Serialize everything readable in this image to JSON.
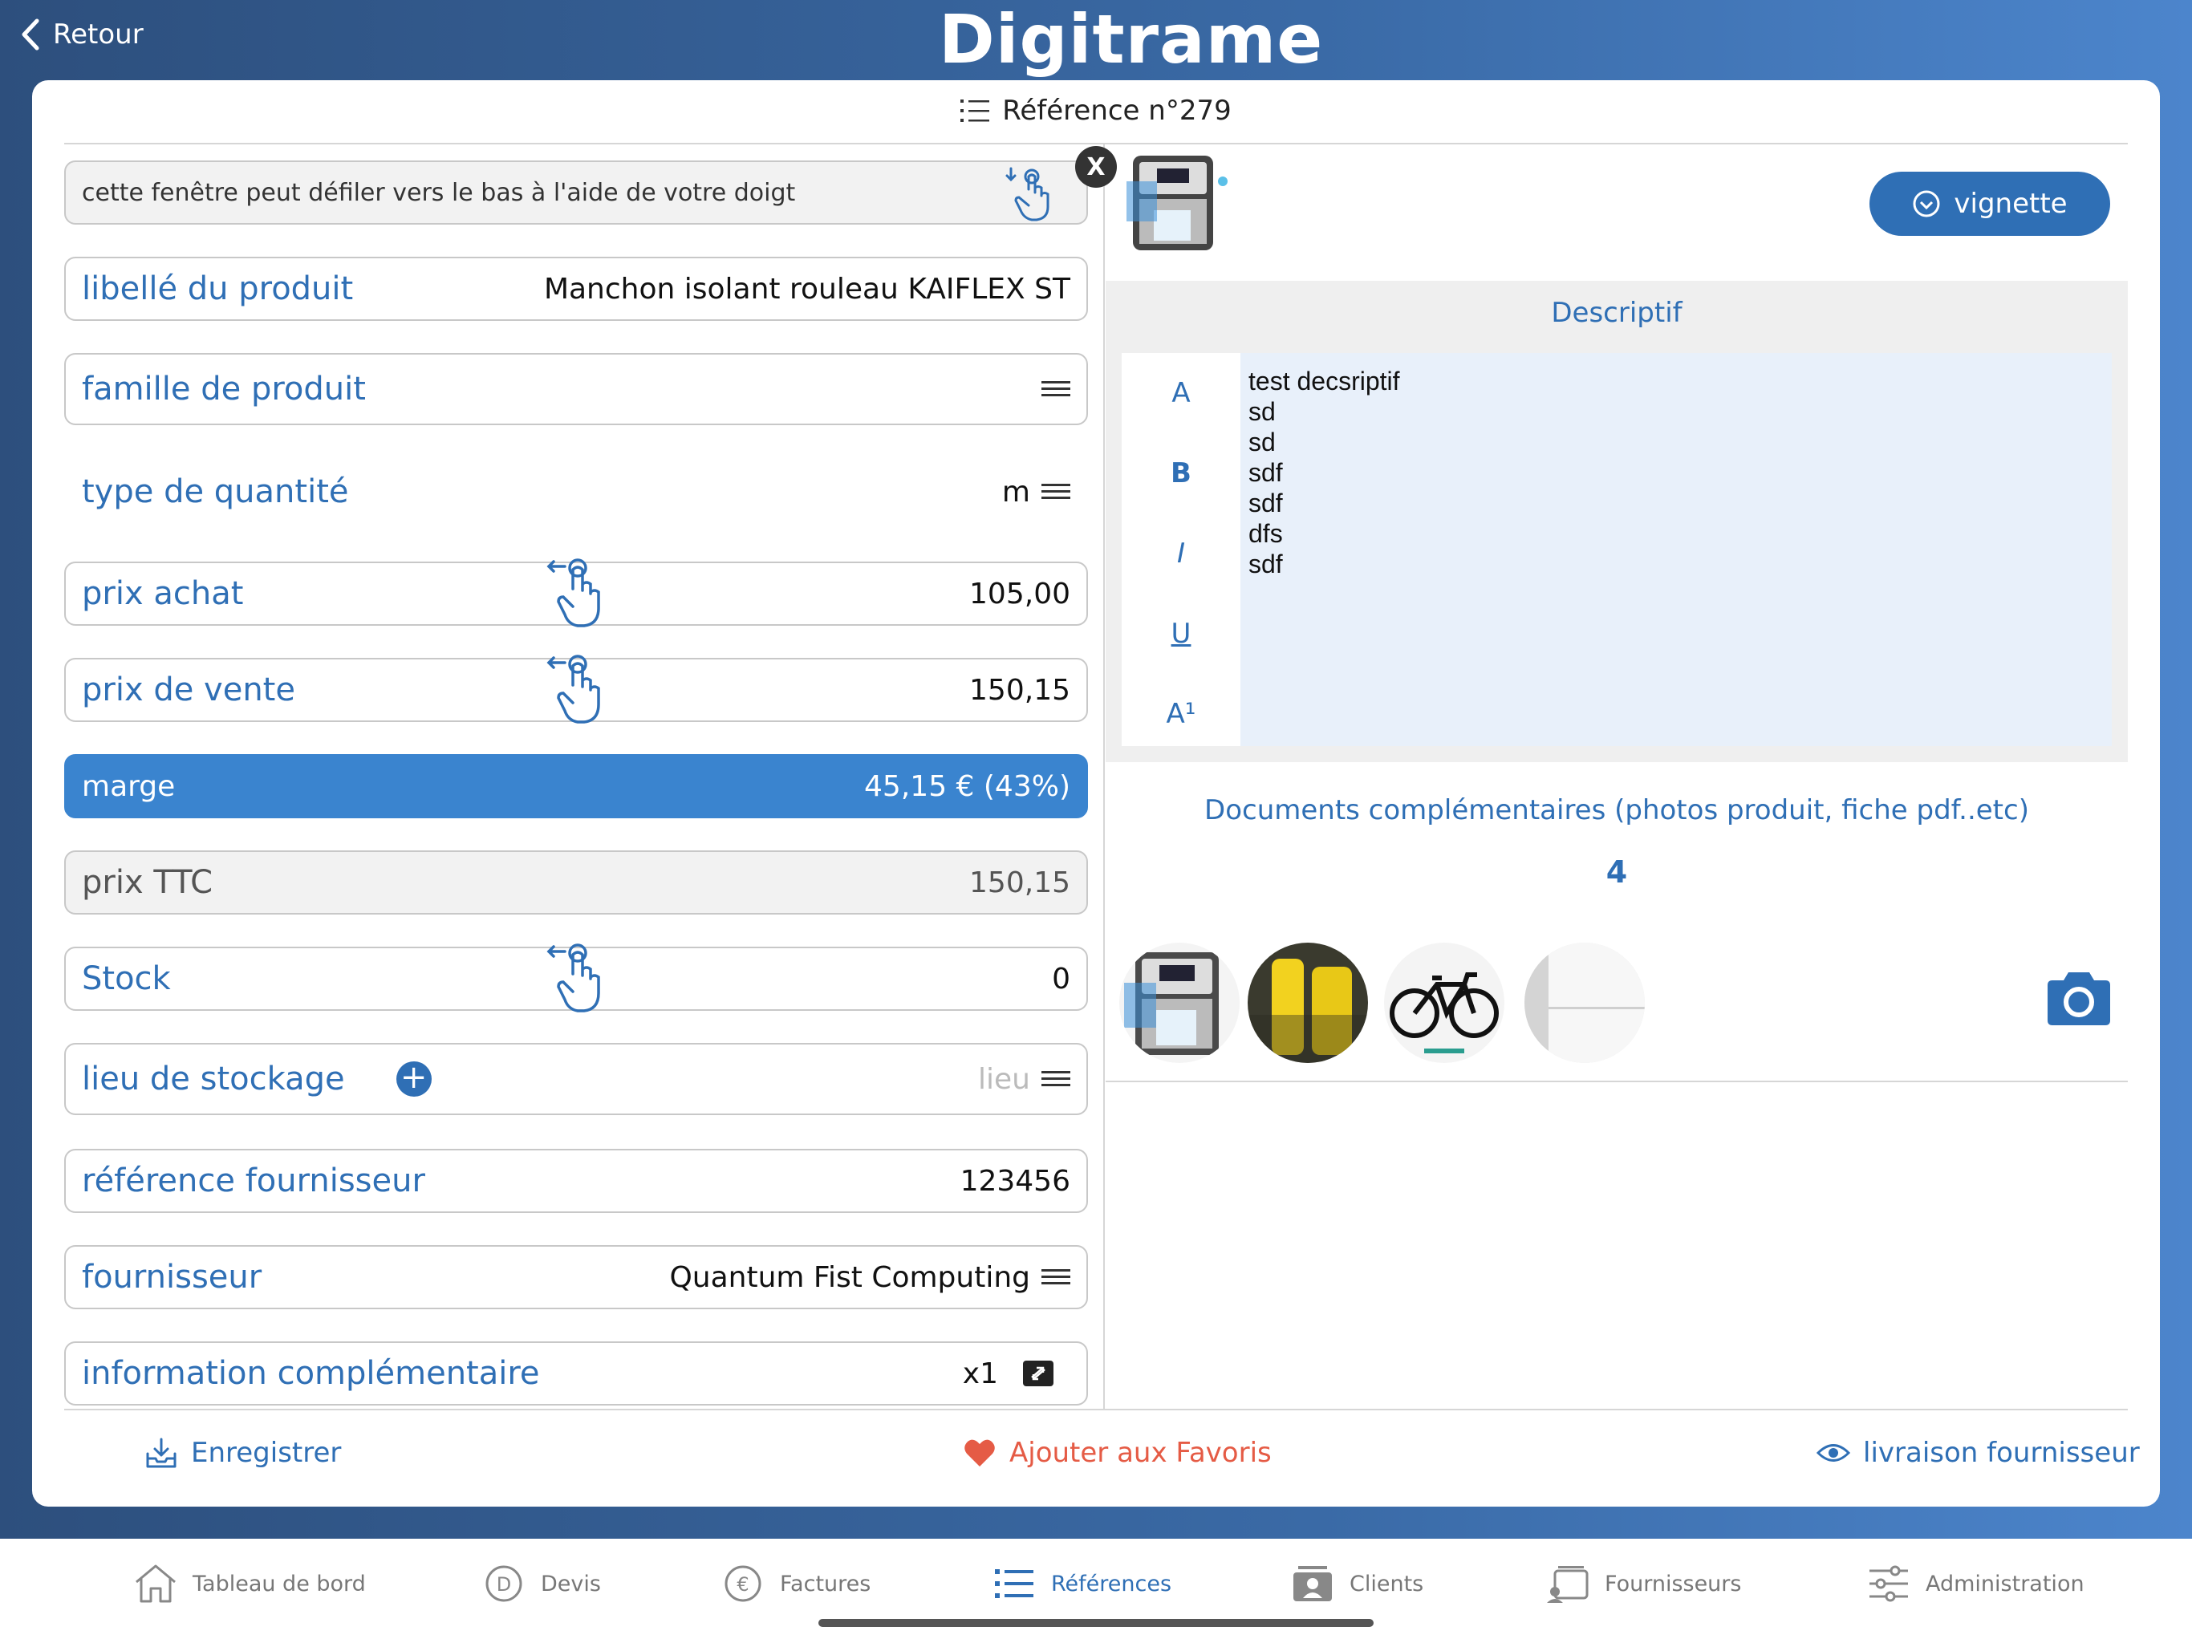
{
  "topbar": {
    "back_label": "Retour",
    "logo": "Digitrame"
  },
  "card": {
    "title": "Référence n°279"
  },
  "hint": {
    "text": "cette fenêtre peut défiler vers le bas à l'aide de votre doigt",
    "close": "X"
  },
  "fields": {
    "libelle": {
      "label": "libellé du produit",
      "value": "Manchon isolant rouleau KAIFLEX ST"
    },
    "famille": {
      "label": "famille de produit"
    },
    "type_qte": {
      "label": "type de quantité",
      "value": "m"
    },
    "prix_achat": {
      "label": "prix achat",
      "value": "105,00"
    },
    "prix_vente": {
      "label": "prix de vente",
      "value": "150,15"
    },
    "marge": {
      "label": "marge",
      "value": "45,15 €   (43%)"
    },
    "prix_ttc": {
      "label": "prix TTC",
      "value": "150,15"
    },
    "stock": {
      "label": "Stock",
      "value": "0"
    },
    "lieu": {
      "label": "lieu de stockage",
      "placeholder": "lieu"
    },
    "ref_fourn": {
      "label": "référence fournisseur",
      "value": "123456"
    },
    "fournisseur": {
      "label": "fournisseur",
      "value": "Quantum Fist Computing"
    },
    "info": {
      "label": "information complémentaire",
      "value": "x1"
    }
  },
  "right": {
    "vignette_label": "vignette",
    "desc_title": "Descriptif",
    "toolbar": [
      "A",
      "B",
      "I",
      "U",
      "A¹"
    ],
    "desc_lines": [
      "test decsriptif",
      "sd",
      "sd",
      "sdf",
      "sdf",
      "dfs",
      "sdf"
    ],
    "docs_title": "Documents complémentaires (photos produit, fiche pdf..etc)",
    "docs_count": "4"
  },
  "actions": {
    "save": "Enregistrer",
    "favorite": "Ajouter aux Favoris",
    "delivery": "livraison fournisseur"
  },
  "tabs": [
    {
      "label": "Tableau de bord",
      "icon": "home-icon"
    },
    {
      "label": "Devis",
      "icon": "devis-icon"
    },
    {
      "label": "Factures",
      "icon": "euro-icon"
    },
    {
      "label": "Références",
      "icon": "list-icon",
      "active": true
    },
    {
      "label": "Clients",
      "icon": "client-icon"
    },
    {
      "label": "Fournisseurs",
      "icon": "supplier-icon"
    },
    {
      "label": "Administration",
      "icon": "sliders-icon"
    }
  ],
  "colors": {
    "accent": "#2f6fb5",
    "marge_bg": "#3a84cf",
    "favorite": "#e55b45"
  }
}
